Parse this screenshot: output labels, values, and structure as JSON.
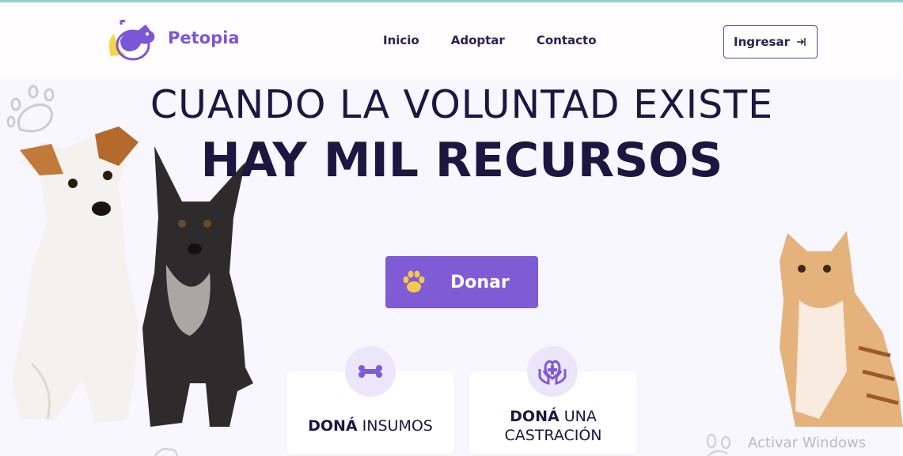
{
  "header": {
    "brand": "Petopia",
    "nav": [
      "Inicio",
      "Adoptar",
      "Contacto"
    ],
    "login_label": "Ingresar"
  },
  "hero": {
    "line1": "CUANDO LA VOLUNTAD EXISTE",
    "line2": "HAY MIL RECURSOS"
  },
  "donate_label": "Donar",
  "cards": [
    {
      "bold": "DONÁ",
      "rest": " INSUMOS",
      "icon": "bone-icon"
    },
    {
      "bold": "DONÁ",
      "rest": " UNA",
      "line2": "CASTRACIÓN",
      "icon": "hands-medical-icon"
    }
  ],
  "watermark": "Activar Windows",
  "colors": {
    "accent": "#7f5bd6",
    "brand_text": "#7b56d6",
    "dark_text": "#1d1640",
    "background": "#f8f6fe",
    "paw_yellow": "#f7c948"
  }
}
